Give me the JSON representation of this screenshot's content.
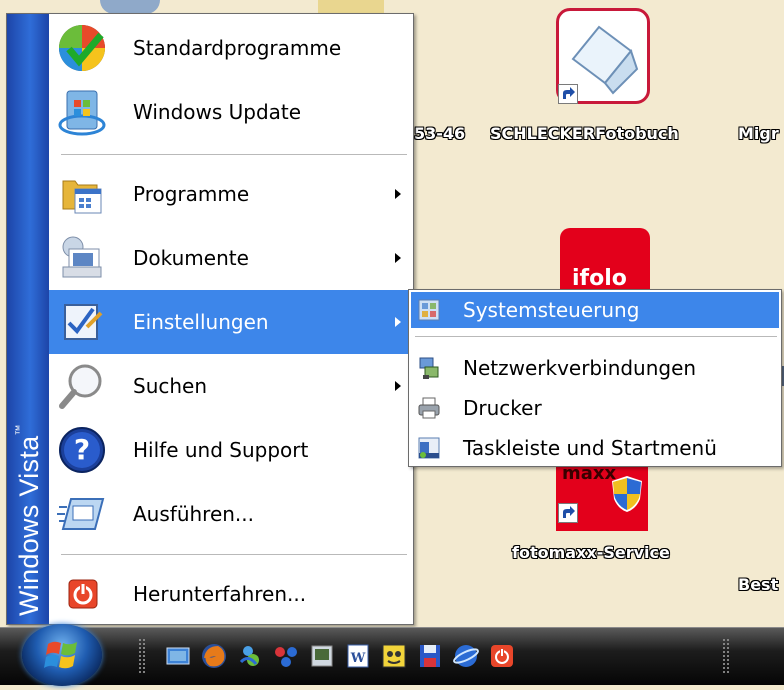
{
  "brand": {
    "text": "Windows Vista",
    "tm": "™",
    "color": "#1d45a8"
  },
  "menu": {
    "items": [
      {
        "label": "Standardprogramme",
        "icon": "default-programs-icon",
        "has_submenu": false
      },
      {
        "label": "Windows Update",
        "icon": "windows-update-icon",
        "has_submenu": false
      },
      {
        "label": "Programme",
        "icon": "programs-folder-icon",
        "has_submenu": true
      },
      {
        "label": "Dokumente",
        "icon": "documents-icon",
        "has_submenu": true
      },
      {
        "label": "Einstellungen",
        "icon": "settings-checklist-icon",
        "has_submenu": true,
        "active": true
      },
      {
        "label": "Suchen",
        "icon": "search-magnifier-icon",
        "has_submenu": true
      },
      {
        "label": "Hilfe und Support",
        "icon": "help-icon",
        "has_submenu": false
      },
      {
        "label": "Ausführen...",
        "icon": "run-icon",
        "has_submenu": false
      },
      {
        "label": "Herunterfahren...",
        "icon": "shutdown-icon",
        "has_submenu": false
      }
    ],
    "highlight_color": "#3d86ea"
  },
  "submenu": {
    "items": [
      {
        "label": "Systemsteuerung",
        "icon": "control-panel-icon",
        "active": true
      },
      {
        "label": "Netzwerkverbindungen",
        "icon": "network-connections-icon"
      },
      {
        "label": "Drucker",
        "icon": "printer-icon"
      },
      {
        "label": "Taskleiste und Startmenü",
        "icon": "taskbar-startmenu-icon"
      }
    ]
  },
  "desktop": {
    "labels": {
      "partial_number": "53-46",
      "schlecker": "SCHLECKERFotobuch",
      "migr": "Migr",
      "fotomaxx": "fotomaxx-Service",
      "best": "Best",
      "ifolor_partial": "ifolo",
      "maxx_partial": "maxx"
    }
  },
  "taskbar": {
    "quick_launch": [
      "show-desktop-icon",
      "firefox-icon",
      "messenger-icon",
      "network-icon",
      "photo-icon",
      "word-icon",
      "avatar-icon",
      "floppy-save-icon",
      "globe-icon",
      "shutdown-icon"
    ]
  }
}
